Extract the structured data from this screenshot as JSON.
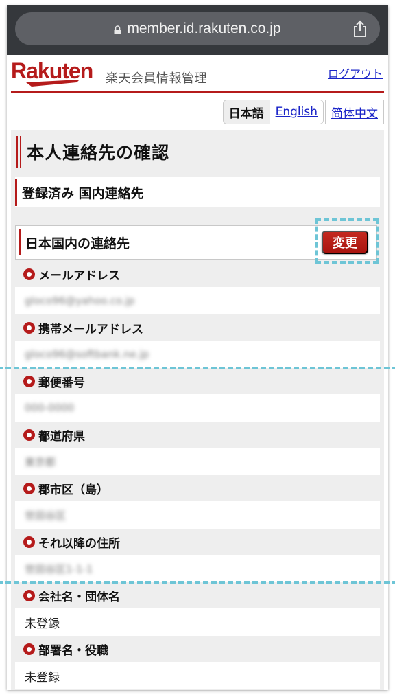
{
  "browser": {
    "url": "member.id.rakuten.co.jp",
    "lock_icon": "lock-icon",
    "share_icon": "share-icon"
  },
  "header": {
    "logo_text": "Rakuten",
    "site_title": "楽天会員情報管理",
    "logout_label": "ログアウト",
    "brand_color": "#b51b1b"
  },
  "languages": [
    {
      "label": "日本語",
      "active": true
    },
    {
      "label": "English",
      "active": false
    },
    {
      "label": "简体中文",
      "active": false
    }
  ],
  "main": {
    "page_heading": "本人連絡先の確認",
    "sub_heading": "登録済み 国内連絡先",
    "section_heading": "日本国内の連絡先",
    "change_button_label": "変更",
    "fields": [
      {
        "label": "メールアドレス",
        "value": "gloco96@yahoo.co.jp",
        "blurred": true
      },
      {
        "label": "携帯メールアドレス",
        "value": "gloco96@softbank.ne.jp",
        "blurred": true
      },
      {
        "label": "郵便番号",
        "value": "000-0000",
        "blurred": true
      },
      {
        "label": "都道府県",
        "value": "東京都",
        "blurred": true
      },
      {
        "label": "郡市区（島）",
        "value": "世田谷区",
        "blurred": true
      },
      {
        "label": "それ以降の住所",
        "value": "世田谷区1-1-1",
        "blurred": true
      },
      {
        "label": "会社名・団体名",
        "value": "未登録",
        "blurred": false
      },
      {
        "label": "部署名・役職",
        "value": "未登録",
        "blurred": false
      }
    ]
  },
  "highlight_color": "#6ec5d6"
}
